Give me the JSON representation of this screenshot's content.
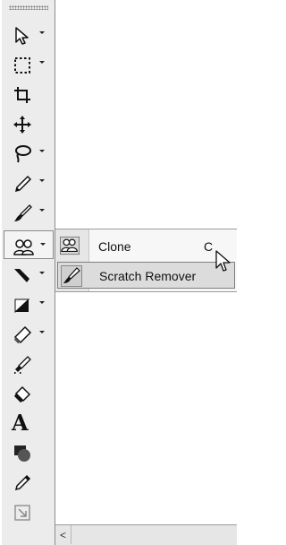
{
  "toolbar": {
    "tools": [
      {
        "icon": "pointer-icon",
        "has_flyout": true
      },
      {
        "icon": "marquee-select-icon",
        "has_flyout": true
      },
      {
        "icon": "crop-icon",
        "has_flyout": false
      },
      {
        "icon": "move-icon",
        "has_flyout": false
      },
      {
        "icon": "lasso-icon",
        "has_flyout": true
      },
      {
        "icon": "pencil-icon",
        "has_flyout": true
      },
      {
        "icon": "brush-icon",
        "has_flyout": true
      },
      {
        "icon": "clone-stamp-icon",
        "has_flyout": true,
        "active": true
      },
      {
        "icon": "smudge-icon",
        "has_flyout": true
      },
      {
        "icon": "dodge-burn-icon",
        "has_flyout": true
      },
      {
        "icon": "eraser-icon",
        "has_flyout": true
      },
      {
        "icon": "color-replacer-icon",
        "has_flyout": false
      },
      {
        "icon": "paint-bucket-icon",
        "has_flyout": false
      },
      {
        "icon": "text-tool-icon",
        "label": "A",
        "has_flyout": false
      },
      {
        "icon": "shape-tool-icon",
        "has_flyout": false
      },
      {
        "icon": "eyedropper-icon",
        "has_flyout": false
      },
      {
        "icon": "transform-icon",
        "has_flyout": false
      }
    ]
  },
  "flyout_menu": {
    "items": [
      {
        "label": "Clone",
        "shortcut": "C",
        "icon": "clone-icon",
        "highlighted": false
      },
      {
        "label": "Scratch Remover",
        "shortcut": "",
        "icon": "scratch-remover-icon",
        "highlighted": true
      }
    ]
  },
  "scrollbar": {
    "left_arrow": "<"
  }
}
